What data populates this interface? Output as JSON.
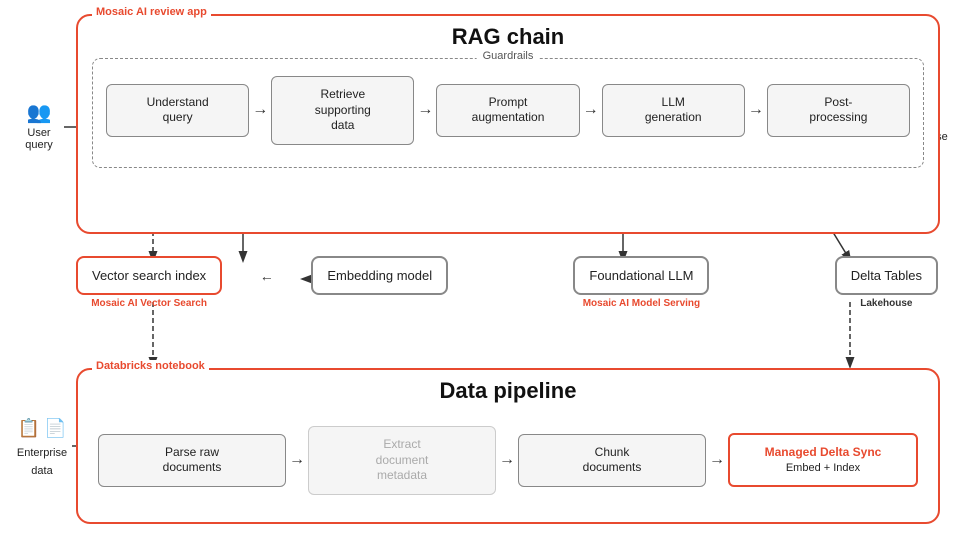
{
  "rag": {
    "app_label": "Mosaic AI review app",
    "title": "RAG chain",
    "guardrails_label": "Guardrails",
    "pipeline_steps": [
      {
        "label": "Understand\nquery"
      },
      {
        "label": "Retrieve\nsupporting\ndata"
      },
      {
        "label": "Prompt\naugmentation"
      },
      {
        "label": "LLM\ngeneration"
      },
      {
        "label": "Post-\nprocessing"
      }
    ],
    "user_query_label": "User\nquery",
    "response_label": "Response\nto user"
  },
  "middle": {
    "vector_search_label": "Vector search index",
    "vector_search_sublabel": "Mosaic AI Vector Search",
    "embedding_label": "Embedding model",
    "foundational_label": "Foundational LLM",
    "foundational_sublabel": "Mosaic AI Model Serving",
    "delta_label": "Delta Tables",
    "delta_sublabel": "Lakehouse"
  },
  "data_pipeline": {
    "notebook_label": "Databricks notebook",
    "title": "Data pipeline",
    "steps": [
      {
        "label": "Parse raw\ndocuments",
        "style": "normal"
      },
      {
        "label": "Extract\ndocument\nmetadata",
        "style": "grayed"
      },
      {
        "label": "Chunk\ndocuments",
        "style": "normal"
      },
      {
        "title": "Managed Delta Sync",
        "label": "Embed + Index",
        "style": "highlighted"
      }
    ],
    "enterprise_label": "Enterprise\ndata"
  },
  "icons": {
    "user": "👥",
    "doc1": "📋",
    "doc2": "📄",
    "arrow_right": "→",
    "arrow_left": "←",
    "arrow_down": "↓"
  }
}
